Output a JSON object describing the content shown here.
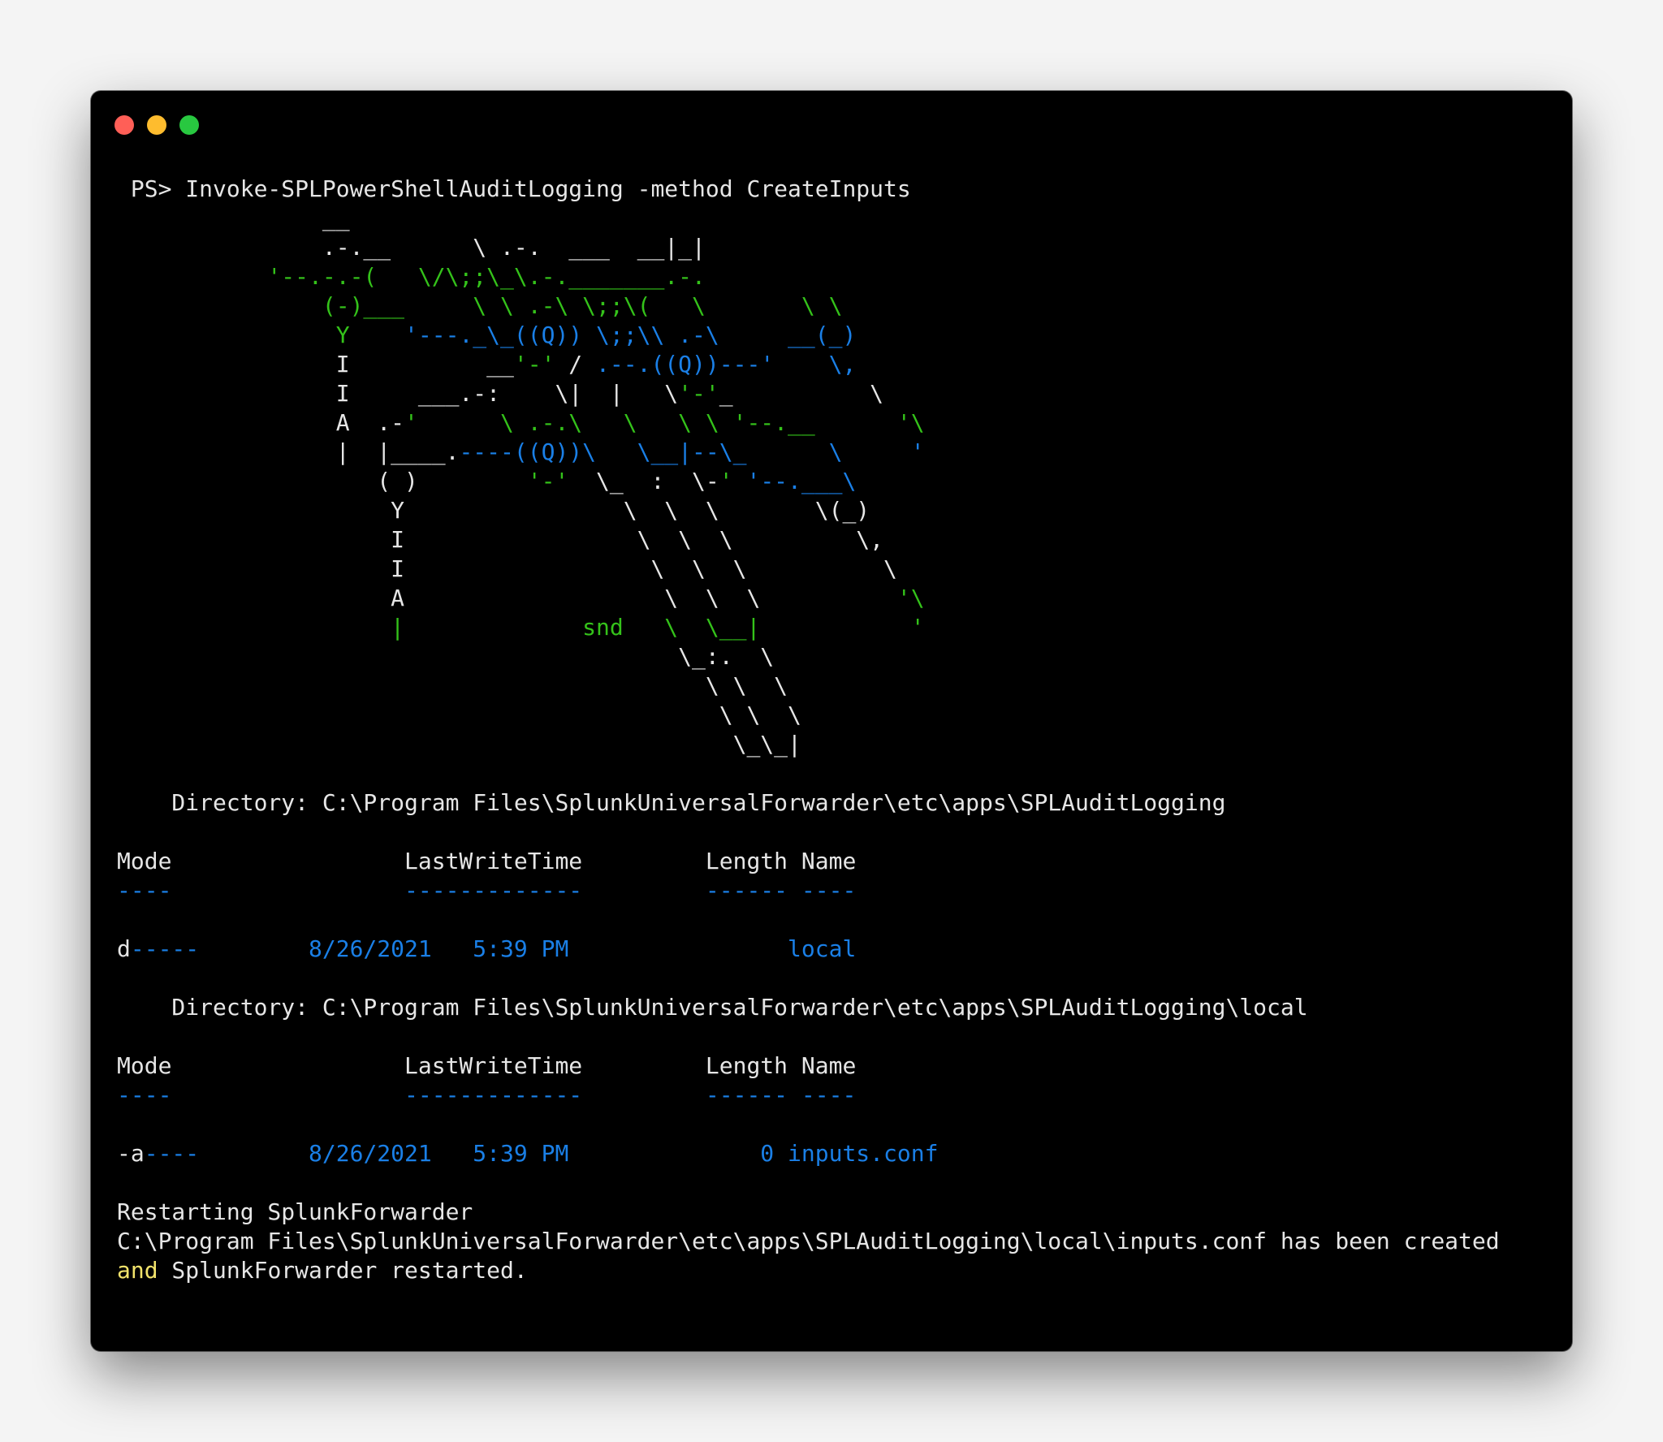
{
  "window": {
    "colors": {
      "background": "#000000",
      "text": "#e6e6e6",
      "green": "#34c21a",
      "blue": "#1a7fe6",
      "yellow": "#f2e36b"
    },
    "buttons": [
      "close",
      "minimize",
      "maximize"
    ]
  },
  "terminal": {
    "lines": [
      [
        {
          "c": "w",
          "t": " PS> Invoke-SPLPowerShellAuditLogging -method CreateInputs"
        }
      ],
      [
        {
          "c": "w",
          "t": "               __"
        }
      ],
      [
        {
          "c": "w",
          "t": "               .-.__      \\ .-.  ___  __|_|"
        }
      ],
      [
        {
          "c": "g",
          "t": "           '--.-.-(   \\/\\;;\\_\\.-._______.-."
        }
      ],
      [
        {
          "c": "g",
          "t": "               (-)___     \\ \\ .-\\ \\;;\\(   \\       \\ \\"
        }
      ],
      [
        {
          "c": "g",
          "t": "                Y    "
        },
        {
          "c": "b",
          "t": "'---._\\_((Q)) \\;;\\\\ .-\\     __(_)"
        }
      ],
      [
        {
          "c": "w",
          "t": "                I          __"
        },
        {
          "c": "g",
          "t": "'-'"
        },
        {
          "c": "w",
          "t": " / "
        },
        {
          "c": "b",
          "t": ".--.((Q))---'    \\,"
        }
      ],
      [
        {
          "c": "w",
          "t": "                I     ___.-:    \\|  |   \\"
        },
        {
          "c": "g",
          "t": "'-'"
        },
        {
          "c": "w",
          "t": "_          \\"
        }
      ],
      [
        {
          "c": "w",
          "t": "                A  .-"
        },
        {
          "c": "g",
          "t": "'      \\ .-.\\   \\   \\ \\ '--.__      '\\"
        }
      ],
      [
        {
          "c": "w",
          "t": "                |  |____."
        },
        {
          "c": "b",
          "t": "----((Q))\\   \\__|--\\_      \\     '"
        }
      ],
      [
        {
          "c": "w",
          "t": "                   ( )        "
        },
        {
          "c": "g",
          "t": "'-'"
        },
        {
          "c": "w",
          "t": "  \\_  :  \\-"
        },
        {
          "c": "g",
          "t": "'"
        },
        {
          "c": "w",
          "t": " "
        },
        {
          "c": "b",
          "t": "'--.___\\"
        }
      ],
      [
        {
          "c": "w",
          "t": "                    Y                \\  \\  \\       \\(_)"
        }
      ],
      [
        {
          "c": "w",
          "t": "                    I                 \\  \\  \\         \\,"
        }
      ],
      [
        {
          "c": "w",
          "t": "                    I                  \\  \\  \\          \\"
        }
      ],
      [
        {
          "c": "w",
          "t": "                    A                   \\  \\  \\          "
        },
        {
          "c": "g",
          "t": "'\\"
        }
      ],
      [
        {
          "c": "g",
          "t": "                    |             snd   \\  \\__|           '"
        }
      ],
      [
        {
          "c": "w",
          "t": "                                         \\_:.  \\"
        }
      ],
      [
        {
          "c": "w",
          "t": "                                           \\ \\  \\"
        }
      ],
      [
        {
          "c": "w",
          "t": "                                            \\ \\  \\"
        }
      ],
      [
        {
          "c": "w",
          "t": "                                             \\_\\_|"
        }
      ],
      [],
      [
        {
          "c": "w",
          "t": "    Directory: C:\\Program Files\\SplunkUniversalForwarder\\etc\\apps\\SPLAuditLogging"
        }
      ],
      [],
      [
        {
          "c": "w",
          "t": "Mode                 LastWriteTime         Length Name"
        }
      ],
      [
        {
          "c": "b",
          "t": "----                 -------------         ------ ----"
        }
      ],
      [],
      [
        {
          "c": "w",
          "t": "d"
        },
        {
          "c": "b",
          "t": "-----        8/26/2021   5:39 PM                local"
        }
      ],
      [],
      [
        {
          "c": "w",
          "t": "    Directory: C:\\Program Files\\SplunkUniversalForwarder\\etc\\apps\\SPLAuditLogging\\local"
        }
      ],
      [],
      [
        {
          "c": "w",
          "t": "Mode                 LastWriteTime         Length Name"
        }
      ],
      [
        {
          "c": "b",
          "t": "----                 -------------         ------ ----"
        }
      ],
      [],
      [
        {
          "c": "w",
          "t": "-a"
        },
        {
          "c": "b",
          "t": "----        8/26/2021   5:39 PM              0 inputs.conf"
        }
      ],
      [],
      [
        {
          "c": "w",
          "t": "Restarting SplunkForwarder"
        }
      ],
      [
        {
          "c": "w",
          "t": "C:\\Program Files\\SplunkUniversalForwarder\\etc\\apps\\SPLAuditLogging\\local\\inputs.conf has been created"
        }
      ],
      [
        {
          "c": "y",
          "t": "and"
        },
        {
          "c": "w",
          "t": " SplunkForwarder restarted."
        }
      ]
    ]
  }
}
